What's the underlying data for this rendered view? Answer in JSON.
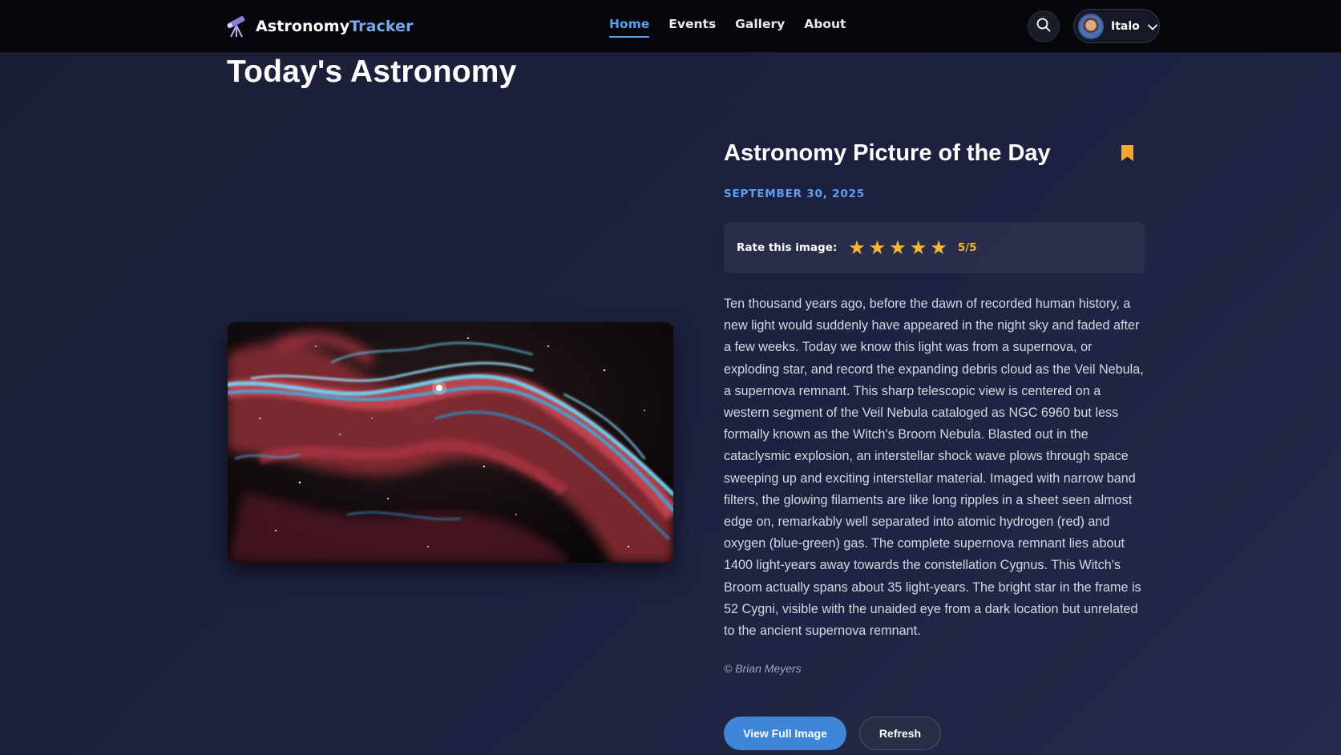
{
  "header": {
    "brand_part1": "Astronomy",
    "brand_part2": "Tracker",
    "nav": [
      {
        "label": "Home",
        "active": true
      },
      {
        "label": "Events",
        "active": false
      },
      {
        "label": "Gallery",
        "active": false
      },
      {
        "label": "About",
        "active": false
      }
    ],
    "search_icon": "search-icon",
    "user_name": "Italo",
    "user_menu_icon": "chevron-down-icon"
  },
  "page": {
    "title": "Today's Astronomy"
  },
  "apod": {
    "title": "Astronomy Picture of the Day",
    "date": "SEPTEMBER 30, 2025",
    "bookmark_icon": "bookmark-icon",
    "rating_label": "Rate this image:",
    "rating_value": "5/5",
    "rating": 5,
    "rating_max": 5,
    "description": "Ten thousand years ago, before the dawn of recorded human history, a new light would suddenly have appeared in the night sky and faded after a few weeks. Today we know this light was from a supernova, or exploding star, and record the expanding debris cloud as the Veil Nebula, a supernova remnant. This sharp telescopic view is centered on a western segment of the Veil Nebula cataloged as NGC 6960 but less formally known as the Witch's Broom Nebula. Blasted out in the cataclysmic explosion, an interstellar shock wave plows through space sweeping up and exciting interstellar material. Imaged with narrow band filters, the glowing filaments are like long ripples in a sheet seen almost edge on, remarkably well separated into atomic hydrogen (red) and oxygen (blue-green) gas. The complete supernova remnant lies about 1400 light-years away towards the constellation Cygnus. This Witch's Broom actually spans about 35 light-years. The bright star in the frame is 52 Cygni, visible with the unaided eye from a dark location but unrelated to the ancient supernova remnant.",
    "credit": "© Brian Meyers",
    "view_button": "View Full Image",
    "refresh_button": "Refresh"
  },
  "colors": {
    "accent": "#5d9ef0",
    "star": "#f4b731",
    "bookmark": "#f4a72a",
    "header_bg": "#05070b"
  }
}
